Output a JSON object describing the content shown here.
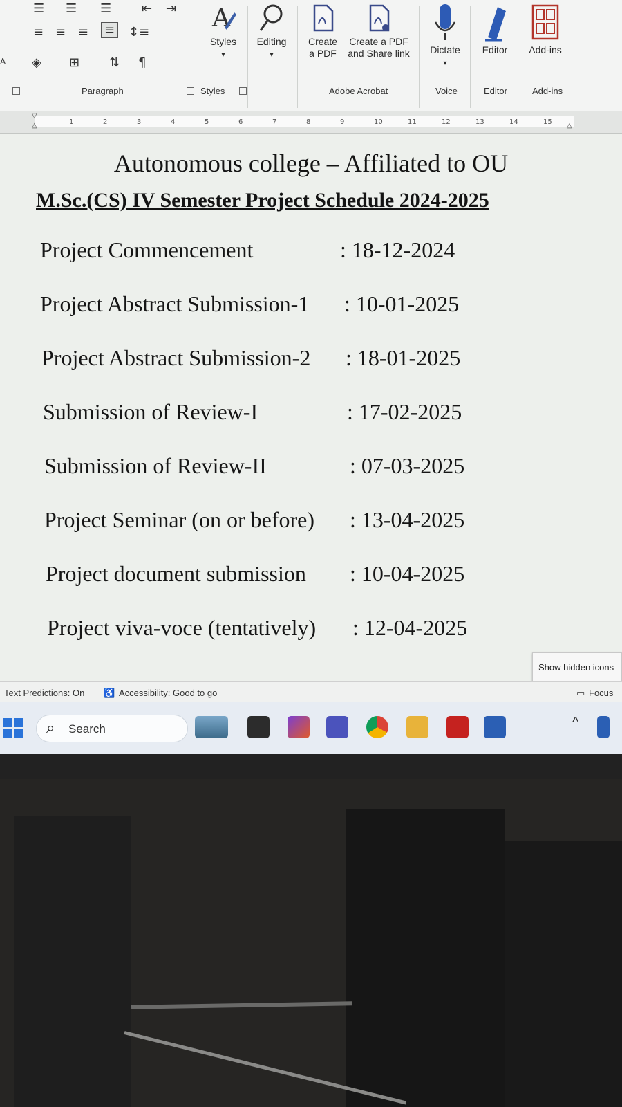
{
  "ribbon": {
    "groups": {
      "paragraph": "Paragraph",
      "styles": "Styles",
      "adobe": "Adobe Acrobat",
      "voice": "Voice",
      "editor": "Editor",
      "addins": "Add-ins"
    },
    "buttons": {
      "styles": "Styles",
      "editing": "Editing",
      "create_pdf_1": "Create",
      "create_pdf_2": "a PDF",
      "create_share_1": "Create a PDF",
      "create_share_2": "and Share link",
      "dictate": "Dictate",
      "editor": "Editor",
      "addins": "Add-ins"
    }
  },
  "ruler": {
    "ticks": [
      "1",
      "2",
      "3",
      "4",
      "5",
      "6",
      "7",
      "8",
      "9",
      "10",
      "11",
      "12",
      "13",
      "14",
      "15"
    ]
  },
  "document": {
    "title": "Autonomous college – Affiliated to OU",
    "subtitle": "M.Sc.(CS) IV Semester Project Schedule 2024-2025",
    "rows": [
      {
        "label": "Project Commencement",
        "date": ": 18-12-2024"
      },
      {
        "label": "Project Abstract Submission-1",
        "date": ": 10-01-2025"
      },
      {
        "label": "Project Abstract Submission-2",
        "date": ": 18-01-2025"
      },
      {
        "label": "Submission of Review-I",
        "date": ": 17-02-2025"
      },
      {
        "label": "Submission of Review-II",
        "date": ": 07-03-2025"
      },
      {
        "label": "Project Seminar (on or before)",
        "date": ": 13-04-2025"
      },
      {
        "label": "Project document submission",
        "date": ": 10-04-2025"
      },
      {
        "label": "Project viva-voce (tentatively)",
        "date": ": 12-04-2025"
      }
    ]
  },
  "tooltip": "Show hidden icons",
  "statusbar": {
    "predictions": "Text Predictions: On",
    "accessibility": "Accessibility: Good to go",
    "focus": "Focus"
  },
  "taskbar": {
    "search_label": "Search"
  }
}
